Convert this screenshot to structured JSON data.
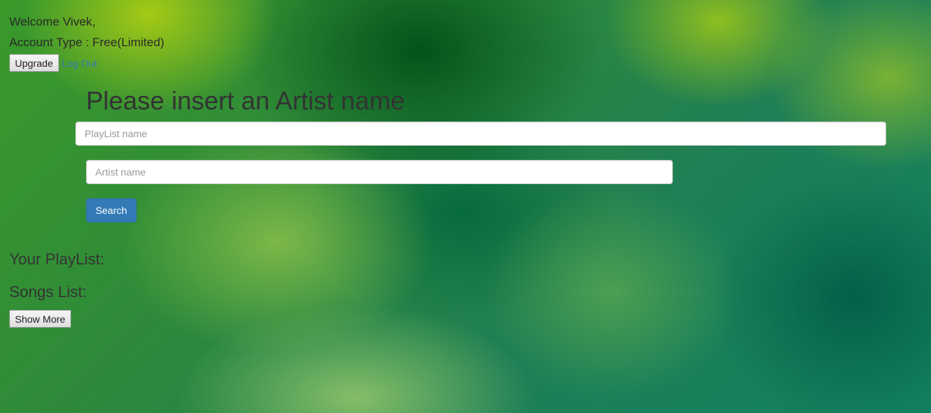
{
  "user": {
    "welcome_text": "Welcome Vivek,",
    "account_type_text": "Account Type : Free(Limited)"
  },
  "account_actions": {
    "upgrade_label": "Upgrade",
    "logout_label": "Log Out"
  },
  "search": {
    "heading": "Please insert an Artist name",
    "playlist_placeholder": "PlayList name",
    "playlist_value": "",
    "artist_placeholder": "Artist name",
    "artist_value": "",
    "search_label": "Search"
  },
  "playlist_section": {
    "heading": "Your PlayList:"
  },
  "songs_section": {
    "heading": "Songs List:",
    "show_more_label": "Show More"
  },
  "colors": {
    "primary_button": "#337ab7",
    "link": "#337ab7",
    "background_theme": "green gradient"
  }
}
